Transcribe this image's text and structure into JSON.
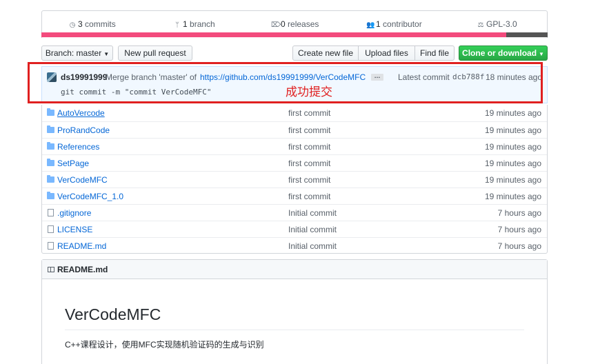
{
  "summary": {
    "commits_count": "3",
    "commits_label": "commits",
    "branch_count": "1",
    "branch_label": "branch",
    "releases_count": "0",
    "releases_label": "releases",
    "contributor_count": "1",
    "contributor_label": "contributor",
    "license": "GPL-3.0",
    "language_colors": [
      "#f34b7d",
      "#555555"
    ]
  },
  "toolbar": {
    "branch_label": "Branch:",
    "branch_value": "master",
    "new_pull_request": "New pull request",
    "create_new_file": "Create new file",
    "upload_files": "Upload files",
    "find_file": "Find file",
    "clone_download": "Clone or download"
  },
  "commit": {
    "author": "ds19991999",
    "message": "Merge branch 'master' of",
    "link": "https://github.com/ds19991999/VerCodeMFC",
    "ellipsis": "…",
    "latest_label": "Latest commit",
    "sha": "dcb788f",
    "time": "18 minutes ago",
    "body": "git commit -m \"commit VerCodeMFC\""
  },
  "annotation": "成功提交",
  "files": [
    {
      "name": "AutoVercode",
      "type": "dir",
      "message": "first commit",
      "age": "19 minutes ago"
    },
    {
      "name": "ProRandCode",
      "type": "dir",
      "message": "first commit",
      "age": "19 minutes ago"
    },
    {
      "name": "References",
      "type": "dir",
      "message": "first commit",
      "age": "19 minutes ago"
    },
    {
      "name": "SetPage",
      "type": "dir",
      "message": "first commit",
      "age": "19 minutes ago"
    },
    {
      "name": "VerCodeMFC",
      "type": "dir",
      "message": "first commit",
      "age": "19 minutes ago"
    },
    {
      "name": "VerCodeMFC_1.0",
      "type": "dir",
      "message": "first commit",
      "age": "19 minutes ago"
    },
    {
      "name": ".gitignore",
      "type": "file",
      "message": "Initial commit",
      "age": "7 hours ago"
    },
    {
      "name": "LICENSE",
      "type": "file",
      "message": "Initial commit",
      "age": "7 hours ago"
    },
    {
      "name": "README.md",
      "type": "file",
      "message": "Initial commit",
      "age": "7 hours ago"
    }
  ],
  "readme": {
    "header": "README.md",
    "title": "VerCodeMFC",
    "description": "C++课程设计，使用MFC实现随机验证码的生成与识别"
  }
}
